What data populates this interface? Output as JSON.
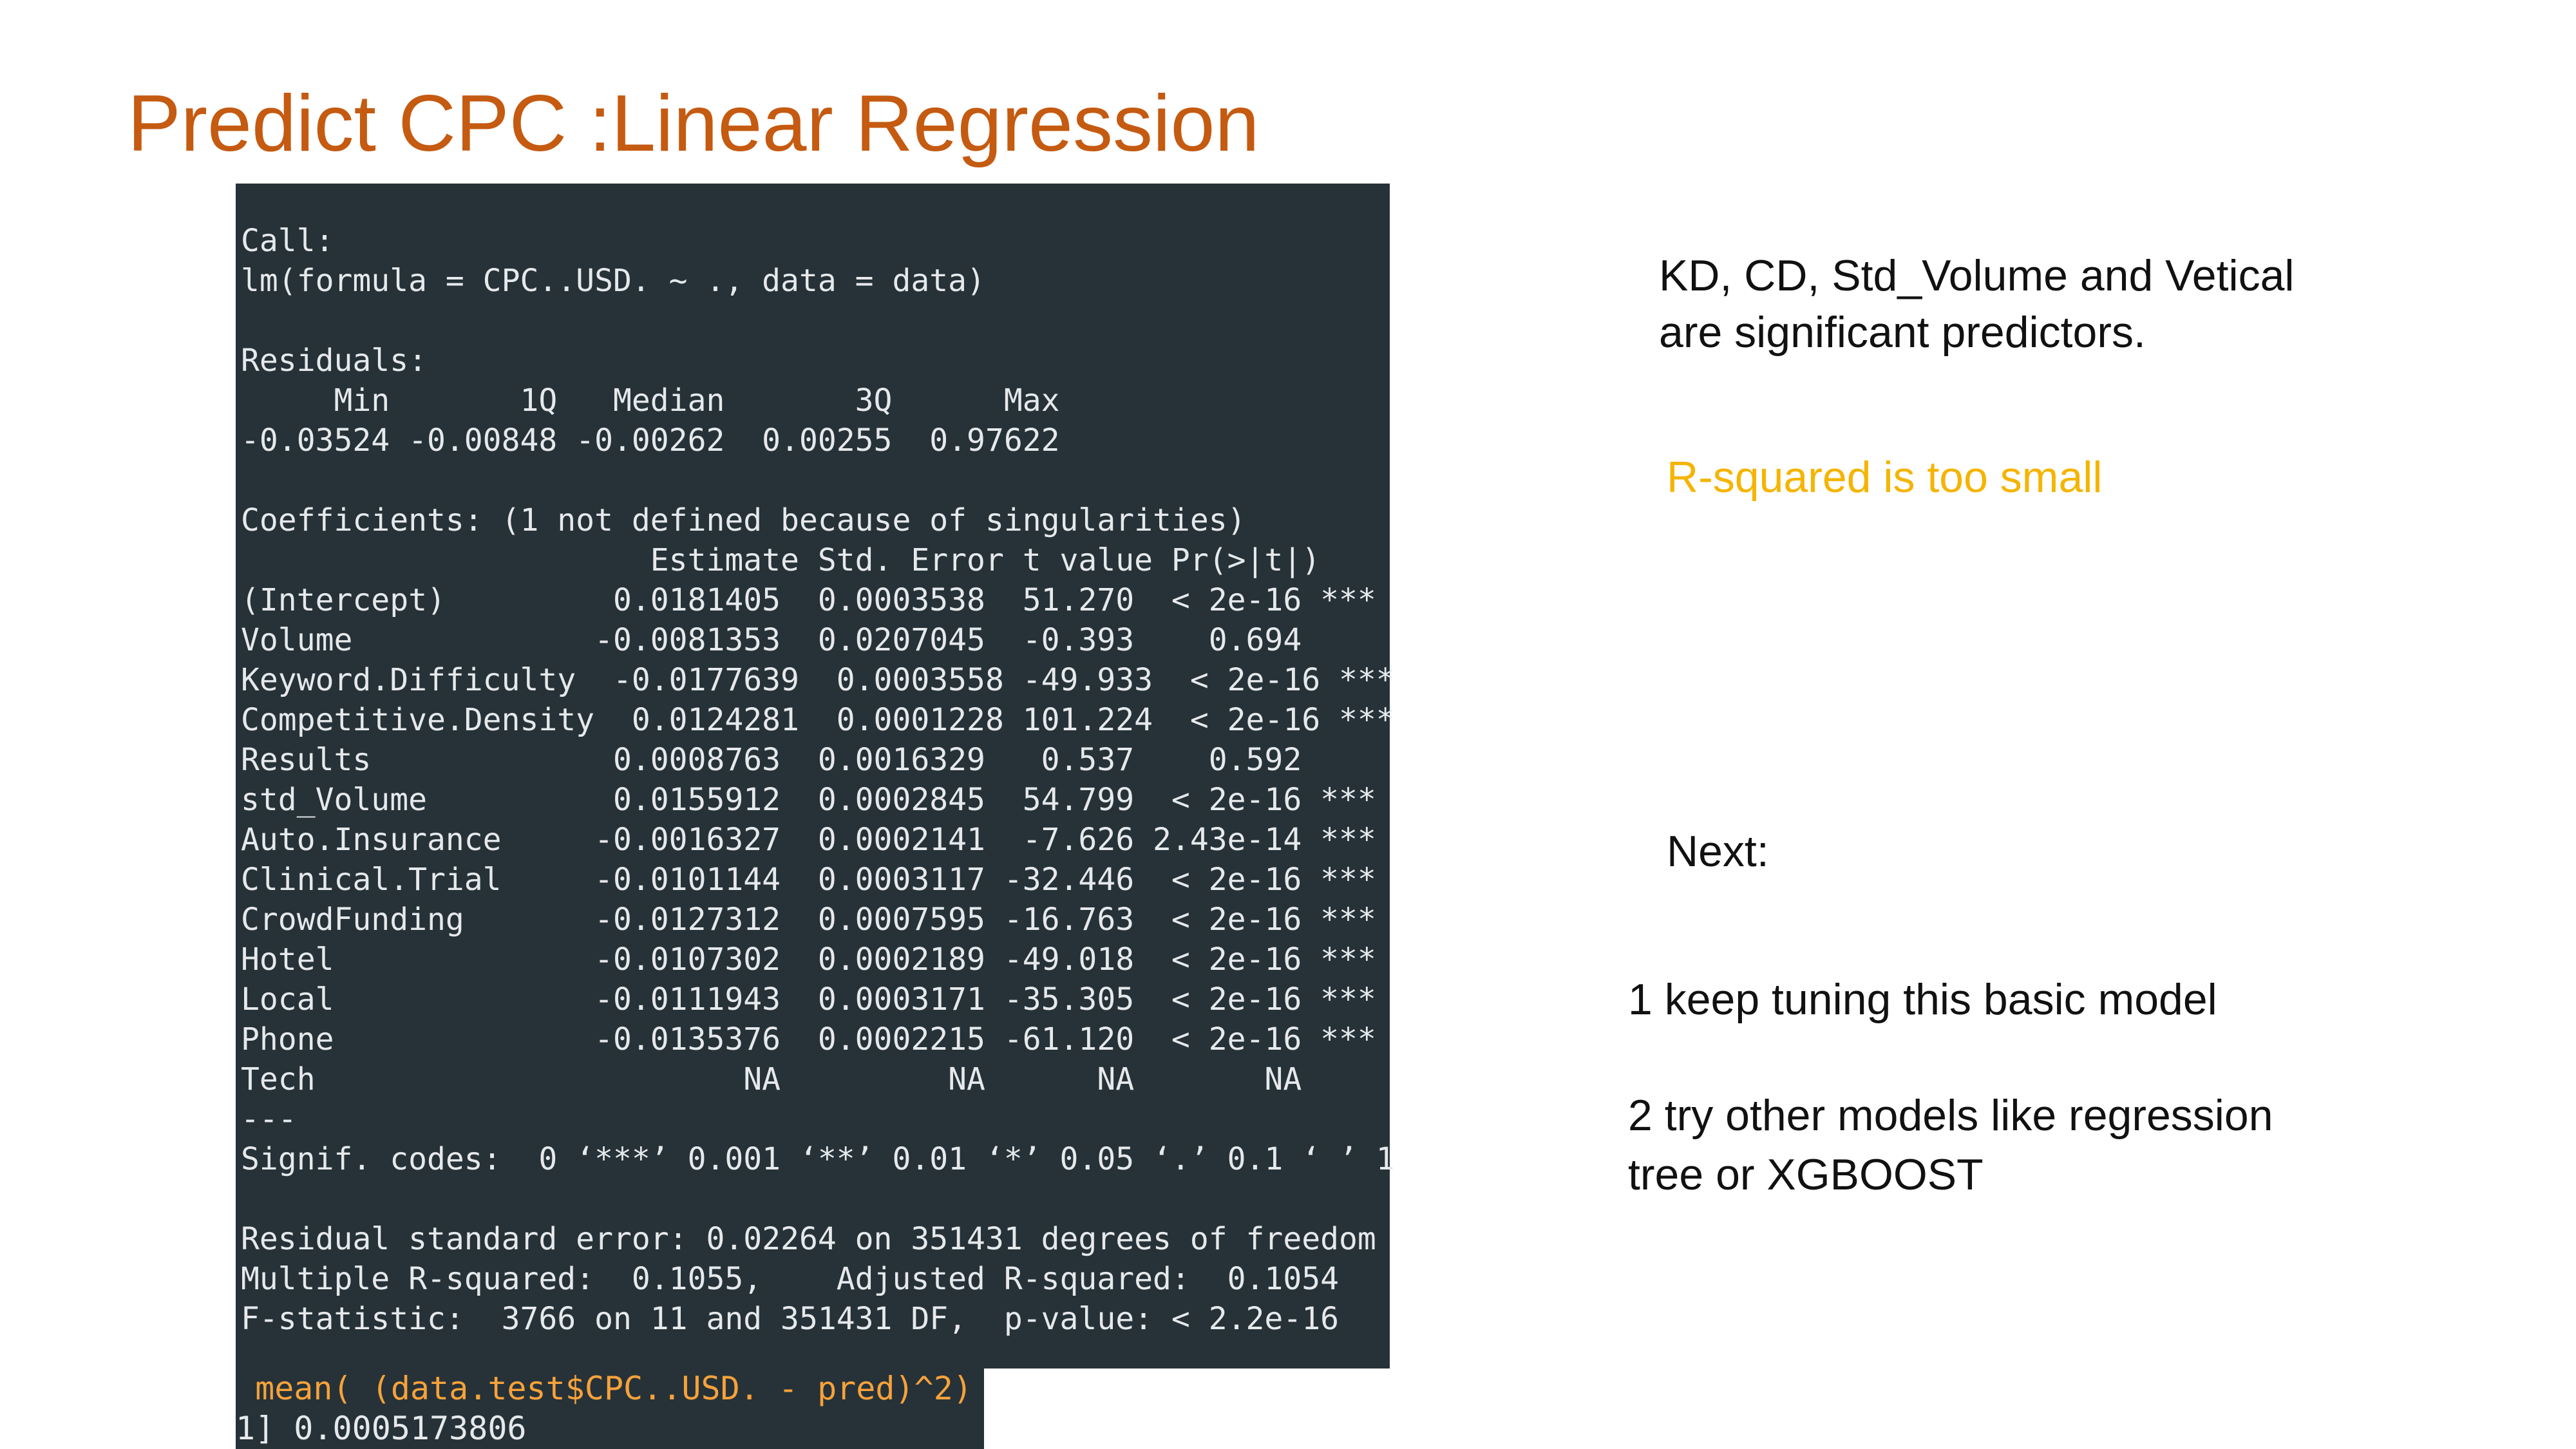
{
  "slide": {
    "title": "Predict CPC :Linear Regression"
  },
  "console": {
    "lines": [
      "Call:",
      "lm(formula = CPC..USD. ~ ., data = data)",
      "",
      "Residuals:",
      "     Min       1Q   Median       3Q      Max",
      "-0.03524 -0.00848 -0.00262  0.00255  0.97622",
      "",
      "Coefficients: (1 not defined because of singularities)",
      "                      Estimate Std. Error t value Pr(>|t|)",
      "(Intercept)         0.0181405  0.0003538  51.270  < 2e-16 ***",
      "Volume             -0.0081353  0.0207045  -0.393    0.694",
      "Keyword.Difficulty  -0.0177639  0.0003558 -49.933  < 2e-16 ***",
      "Competitive.Density  0.0124281  0.0001228 101.224  < 2e-16 ***",
      "Results             0.0008763  0.0016329   0.537    0.592",
      "std_Volume          0.0155912  0.0002845  54.799  < 2e-16 ***",
      "Auto.Insurance     -0.0016327  0.0002141  -7.626 2.43e-14 ***",
      "Clinical.Trial     -0.0101144  0.0003117 -32.446  < 2e-16 ***",
      "CrowdFunding       -0.0127312  0.0007595 -16.763  < 2e-16 ***",
      "Hotel              -0.0107302  0.0002189 -49.018  < 2e-16 ***",
      "Local              -0.0111943  0.0003171 -35.305  < 2e-16 ***",
      "Phone              -0.0135376  0.0002215 -61.120  < 2e-16 ***",
      "Tech                       NA         NA      NA       NA",
      "---",
      "Signif. codes:  0 ‘***’ 0.001 ‘**’ 0.01 ‘*’ 0.05 ‘.’ 0.1 ‘ ’ 1",
      "",
      "Residual standard error: 0.02264 on 351431 degrees of freedom",
      "Multiple R-squared:  0.1055,    Adjusted R-squared:  0.1054",
      "F-statistic:  3766 on 11 and 351431 DF,  p-value: < 2.2e-16"
    ],
    "command": " mean( (data.test$CPC..USD. - pred)^2)",
    "output": "1] 0.0005173806"
  },
  "notes": {
    "significant_line1": "KD, CD, Std_Volume and Vetical",
    "significant_line2": "are significant predictors.",
    "rsquared": "R-squared is too small",
    "next": "Next:",
    "step1": "1 keep tuning this basic model",
    "step2_line1": "2 try other models like regression",
    "step2_line2": "tree or XGBOOST"
  },
  "colors": {
    "title": "#C55A11",
    "highlight": "#F5B400",
    "console_bg": "#263238"
  }
}
